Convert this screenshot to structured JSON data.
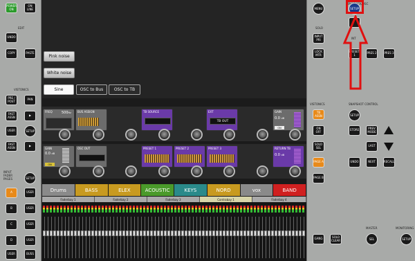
{
  "left": {
    "top_buttons": [
      "POWER ON",
      "ON LINE"
    ],
    "edit_label": "EDIT",
    "edit_buttons": [
      "UNDO",
      "COPY",
      "PASTE"
    ],
    "vistonics_label": "VISTONICS",
    "vist_buttons": [
      "PRE / POST",
      "PAN",
      "FAST ASSN",
      "USER",
      "SETUP",
      "FAST ASSN"
    ],
    "input_label": "INPUT FADER PAGES",
    "fader_buttons": [
      "SETUP",
      "A",
      "USER",
      "B",
      "USER",
      "C",
      "USER",
      "D",
      "USER",
      "USER",
      "BUSS"
    ]
  },
  "right": {
    "talkback_label": "TALKBACK/OSC",
    "menu": "MENU",
    "setup": "SETUP",
    "solo_label": "SOLO",
    "solo_buttons": [
      "INPUT PRI",
      "LOCK MTR",
      "PRESET 1",
      "PRES 2",
      "PRES 3"
    ],
    "int_label": "INT",
    "vistonics_label": "VISTONICS",
    "vist_buttons": [
      "TB ASSN",
      "ON OFF",
      "SOLO SEL",
      "PAGE A",
      "PAGE B"
    ],
    "snapshot_label": "SNAPSHOT CONTROL",
    "snap_buttons": [
      "SETUP",
      "STORE",
      "PREV MODE",
      "LAST",
      "UNDO",
      "NEXT",
      "RECALL"
    ],
    "bottom_buttons": [
      "GANG",
      "SOLO CLEAR",
      "SEL",
      "SETUP"
    ],
    "master_label": "MASTER",
    "monitoring_label": "MONITORING"
  },
  "generator": {
    "buttons": [
      "Pink noise",
      "White noise",
      "Sine",
      "OSC to Bus",
      "OSC to TB"
    ]
  },
  "strip1": {
    "freq_label": "FREQ",
    "freq_value": "500",
    "freq_unit": "Hz",
    "bus_assign": "BUS ASSIGN",
    "tb_source": "TB SOURCE",
    "ext": "EXT",
    "tb_out": "TB OUT",
    "gain_label": "GAIN",
    "gain_value": "0.0",
    "gain_unit": "dB",
    "on_label": "ON"
  },
  "strip2": {
    "gain_label": "GAIN",
    "gain_value": "0.0",
    "gain_unit": "dB",
    "on_label": "ON",
    "osc_out": "OSC OUT",
    "preset1": "PRESET 1",
    "preset2": "PRESET 2",
    "preset3": "PRESET 3",
    "return_tb": "RETURN TB",
    "gain2_value": "0.0",
    "gain2_unit": "dB"
  },
  "scenes": [
    {
      "label": "Drums",
      "color": "#8a8a8a"
    },
    {
      "label": "BASS",
      "color": "#c89a20"
    },
    {
      "label": "ELEX",
      "color": "#c89a20"
    },
    {
      "label": "ACOUSTIC",
      "color": "#4a9a2a"
    },
    {
      "label": "KEYS",
      "color": "#2a8a8a"
    },
    {
      "label": "NORD",
      "color": "#c89a20"
    },
    {
      "label": "vox",
      "color": "#8a8a8a"
    },
    {
      "label": "BAND",
      "color": "#d02020"
    }
  ],
  "faderbays": [
    "Faderbay 1",
    "Faderbay 2",
    "Faderbay 3",
    "Contrabay 1",
    "Faderbay 4"
  ]
}
